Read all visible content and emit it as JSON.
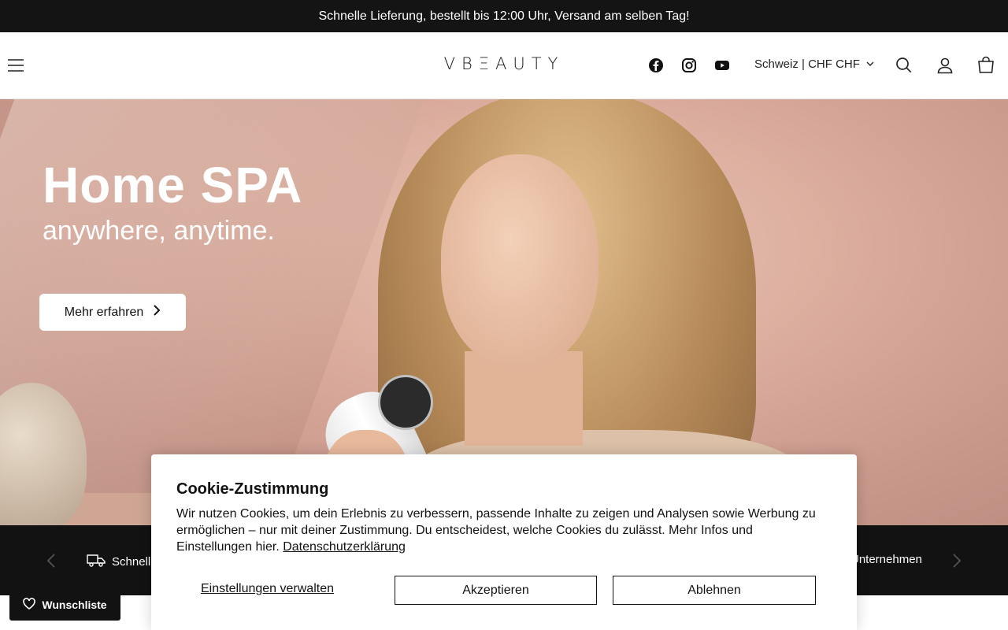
{
  "announcement": {
    "text": "Schnelle Lieferung, bestellt bis 12:00 Uhr, Versand am selben Tag!"
  },
  "header": {
    "logo": "VBΞAUTY",
    "currency": "Schweiz | CHF CHF",
    "icons": [
      "menu-icon",
      "facebook-icon",
      "instagram-icon",
      "youtube-icon",
      "chevron-down-icon",
      "search-icon",
      "account-icon",
      "cart-icon"
    ]
  },
  "hero": {
    "title": "Home SPA",
    "subtitle": "anywhere, anytime.",
    "button_label": "Mehr erfahren"
  },
  "trust_bar": {
    "left_text": "Schnell",
    "right_text": "Unternehmen",
    "icons": [
      "truck-icon",
      "chevron-left-icon",
      "chevron-right-icon"
    ]
  },
  "cookie": {
    "title": "Cookie-Zustimmung",
    "text": "Wir nutzen Cookies, um dein Erlebnis zu verbessern, passende Inhalte zu zeigen und Analysen sowie Werbung zu ermöglichen – nur mit deiner Zustimmung. Du entscheidest, welche Cookies du zulässt. Mehr Infos und Einstellungen hier.",
    "privacy_link": "Datenschutzerklärung",
    "manage_label": "Einstellungen verwalten",
    "accept_label": "Akzeptieren",
    "decline_label": "Ablehnen"
  },
  "wishlist": {
    "label": "Wunschliste"
  },
  "colors": {
    "dark": "#121212",
    "hero_bg": "#dcae9f",
    "white": "#ffffff"
  }
}
